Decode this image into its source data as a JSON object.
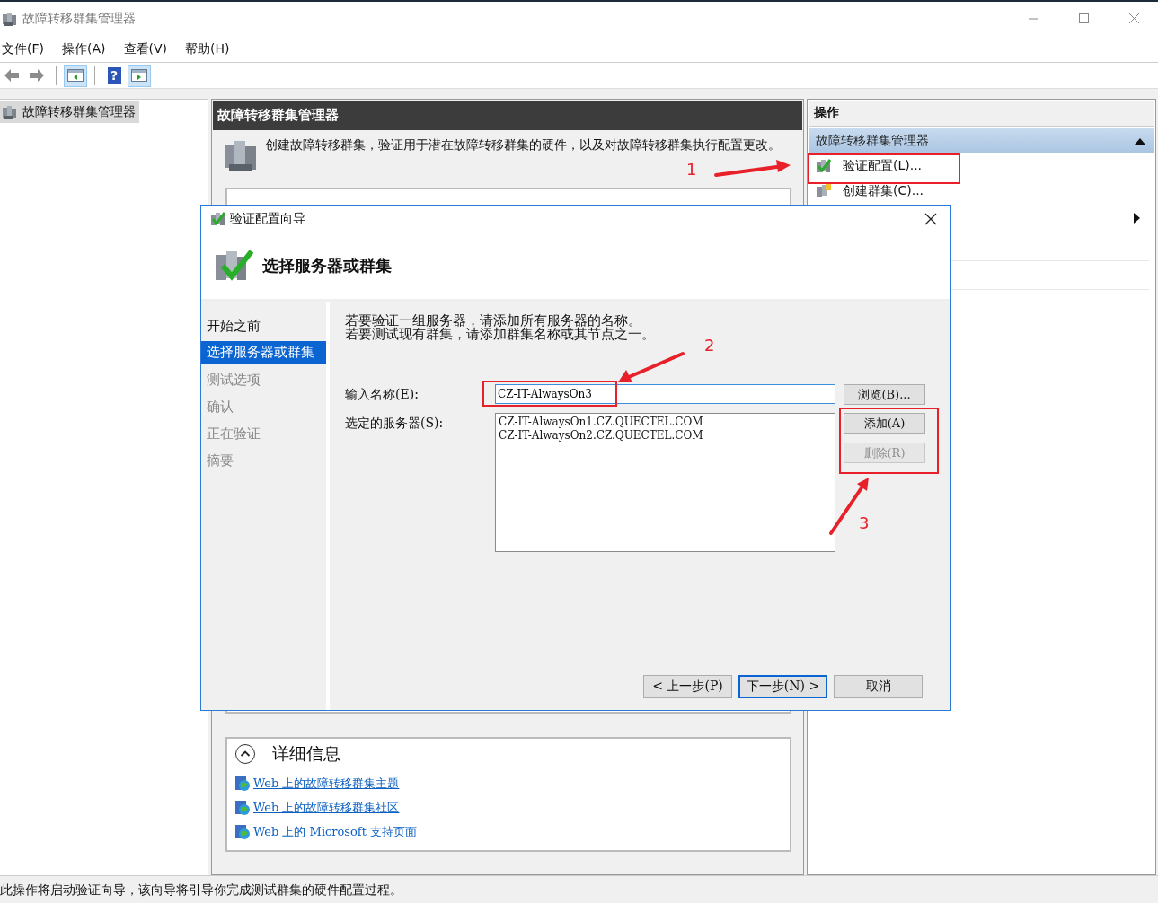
{
  "window": {
    "title": "故障转移群集管理器"
  },
  "menu": [
    "文件(F)",
    "操作(A)",
    "查看(V)",
    "帮助(H)"
  ],
  "toolbar": [
    {
      "kind": "back",
      "pressed": false
    },
    {
      "kind": "forward",
      "pressed": false
    },
    {
      "kind": "separator"
    },
    {
      "kind": "tree-toggle",
      "pressed": true
    },
    {
      "kind": "separator"
    },
    {
      "kind": "help",
      "glyph": "?",
      "pressed": false
    },
    {
      "kind": "pane-toggle",
      "pressed": true
    }
  ],
  "tree": [
    {
      "label": "故障转移群集管理器",
      "selected": true
    }
  ],
  "center": {
    "header": "故障转移群集管理器",
    "description": "创建故障转移群集，验证用于潜在故障转移群集的硬件，以及对故障转移群集执行配置更改。",
    "details": {
      "title": "详细信息",
      "expanded": true,
      "links": [
        "Web 上的故障转移群集主题",
        "Web 上的故障转移群集社区",
        "Web 上的 Microsoft 支持页面"
      ]
    }
  },
  "actions": {
    "header": "操作",
    "group": "故障转移群集管理器",
    "expanded": true,
    "items": [
      {
        "kind": "validate",
        "label": "验证配置(L)..."
      },
      {
        "kind": "create",
        "label": "创建群集(C)..."
      },
      {
        "kind": "submenu"
      },
      {
        "kind": "blank"
      },
      {
        "kind": "blank"
      }
    ]
  },
  "dialog": {
    "title": "验证配置向导",
    "heading": "选择服务器或群集",
    "steps": [
      {
        "label": "开始之前",
        "selected": false,
        "disabled": false
      },
      {
        "label": "选择服务器或群集",
        "selected": true,
        "disabled": false
      },
      {
        "label": "测试选项",
        "selected": false,
        "disabled": true
      },
      {
        "label": "确认",
        "selected": false,
        "disabled": true
      },
      {
        "label": "正在验证",
        "selected": false,
        "disabled": true
      },
      {
        "label": "摘要",
        "selected": false,
        "disabled": true
      }
    ],
    "instructions": [
      "若要验证一组服务器，请添加所有服务器的名称。",
      "若要测试现有群集，请添加群集名称或其节点之一。"
    ],
    "name_label": "输入名称(E):",
    "name_value": "CZ-IT-AlwaysOn3",
    "browse": "浏览(B)...",
    "servers_label": "选定的服务器(S):",
    "servers": [
      "CZ-IT-AlwaysOn1.CZ.QUECTEL.COM",
      "CZ-IT-AlwaysOn2.CZ.QUECTEL.COM"
    ],
    "side_buttons": [
      {
        "label": "添加(A)",
        "disabled": false
      },
      {
        "label": "删除(R)",
        "disabled": true
      }
    ],
    "footer_buttons": [
      {
        "label": "< 上一步(P)",
        "default": false
      },
      {
        "label": "下一步(N) >",
        "default": true
      },
      {
        "label": "取消",
        "default": false
      }
    ]
  },
  "annotations": [
    {
      "number": "1"
    },
    {
      "number": "2"
    },
    {
      "number": "3"
    }
  ],
  "status_bar": "此操作将启动验证向导，该向导将引导你完成测试群集的硬件配置过程。"
}
